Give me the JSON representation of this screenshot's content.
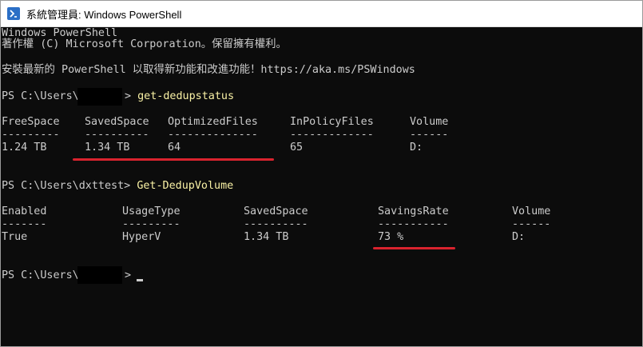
{
  "window": {
    "title": "系統管理員: Windows PowerShell"
  },
  "console": {
    "banner1": "Windows PowerShell",
    "banner2": "著作權 (C) Microsoft Corporation。保留擁有權利。",
    "banner3": "安裝最新的 PowerShell 以取得新功能和改進功能！https://aka.ms/PSWindows",
    "prompt1_prefix": "PS C:\\Users\\",
    "prompt1_suffix": ">",
    "cmd1": "get-dedupstatus",
    "table1": {
      "headers": [
        "FreeSpace",
        "SavedSpace",
        "OptimizedFiles",
        "InPolicyFiles",
        "Volume"
      ],
      "dashes": [
        "---------",
        "----------",
        "--------------",
        "-------------",
        "------"
      ],
      "row": [
        "1.24 TB",
        "1.34 TB",
        "64",
        "65",
        "D:"
      ]
    },
    "prompt2": "PS C:\\Users\\dxttest>",
    "cmd2": "Get-DedupVolume",
    "table2": {
      "headers": [
        "Enabled",
        "UsageType",
        "SavedSpace",
        "SavingsRate",
        "Volume"
      ],
      "dashes": [
        "-------",
        "---------",
        "----------",
        "-----------",
        "------"
      ],
      "row": [
        "True",
        "HyperV",
        "1.34 TB",
        "73 %",
        "D:"
      ]
    },
    "prompt3_prefix": "PS C:\\Users\\",
    "prompt3_suffix": ">"
  },
  "colors": {
    "background": "#0c0c0c",
    "text": "#cccccc",
    "command": "#f9f1a5",
    "annotation": "#d9232e"
  },
  "icons": {
    "app": "powershell-icon"
  }
}
